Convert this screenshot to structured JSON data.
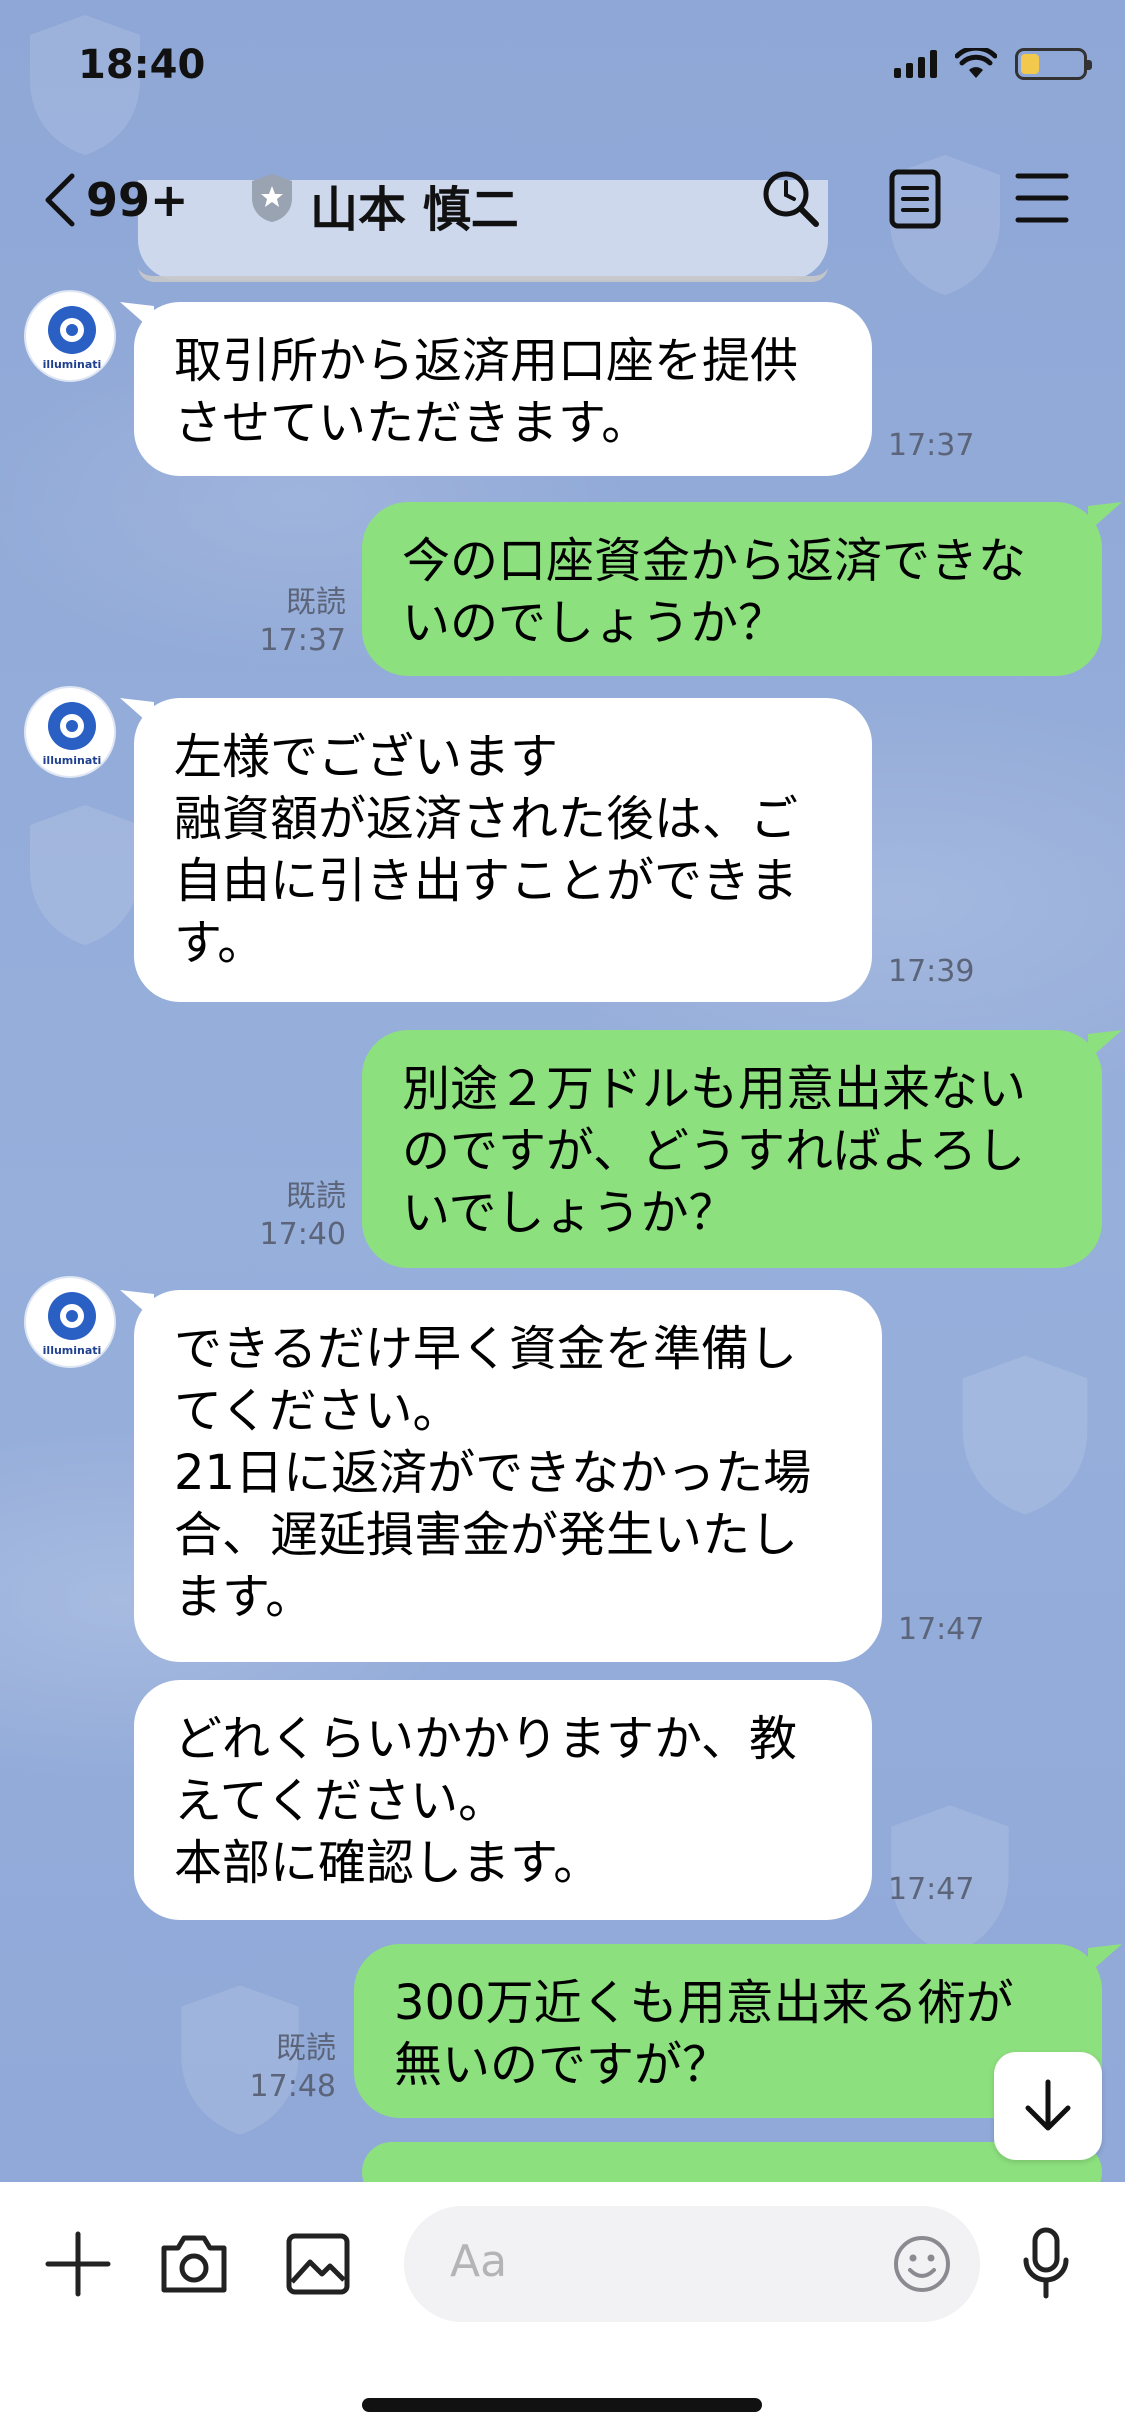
{
  "status": {
    "time": "18:40"
  },
  "header": {
    "back_count": "99+",
    "title": "山本 慎二"
  },
  "messages": [
    {
      "side": "in",
      "text": "取引所から返済用口座を提供\nさせていただきます。",
      "time": "17:37"
    },
    {
      "side": "out",
      "text": "今の口座資金から返済できな\nいのでしょうか？",
      "read": "既読",
      "time": "17:37"
    },
    {
      "side": "in",
      "text": "左様でございます\n融資額が返済された後は、ご\n自由に引き出すことができま\nす。",
      "time": "17:39"
    },
    {
      "side": "out",
      "text": "別途２万ドルも用意出来ない\nのですが、どうすればよろし\nいでしょうか？",
      "read": "既読",
      "time": "17:40"
    },
    {
      "side": "in",
      "text": "できるだけ早く資金を準備し\nてください。\n21日に返済ができなかった場\n合、遅延損害金が発生いたし\nます。",
      "time": "17:47"
    },
    {
      "side": "in",
      "text": "どれくらいかかりますか、教\nえてください。\n本部に確認します。",
      "time": "17:47"
    },
    {
      "side": "out",
      "text": "300万近くも用意出来る術が\n無いのですが？",
      "read": "既読",
      "time": "17:48"
    }
  ],
  "avatar": {
    "label": "illuminati"
  },
  "input": {
    "placeholder": "Aa"
  },
  "colors": {
    "background": "#8ea9d9",
    "incoming_bubble": "#ffffff",
    "outgoing_bubble": "#8de07e"
  },
  "icons": [
    "chevron-left-icon",
    "shield-icon",
    "search-icon",
    "notes-icon",
    "menu-icon",
    "plus-icon",
    "camera-icon",
    "image-icon",
    "emoji-icon",
    "mic-icon",
    "arrow-down-icon"
  ]
}
